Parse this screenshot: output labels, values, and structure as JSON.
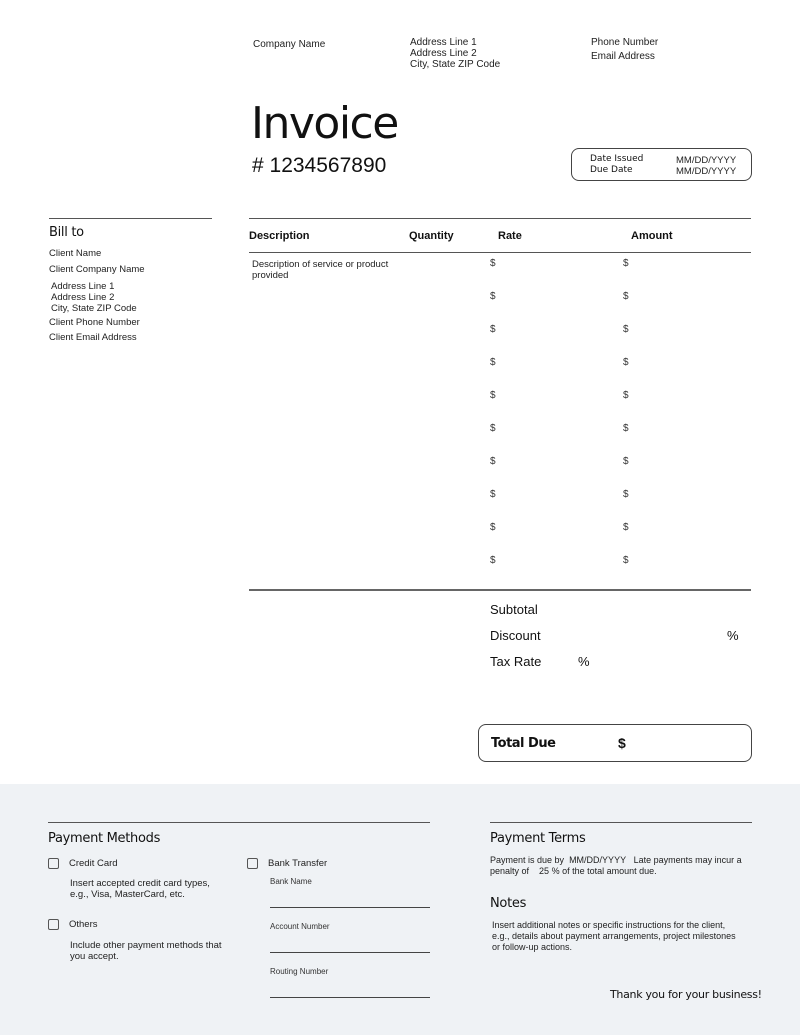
{
  "company": {
    "name": "Company Name",
    "address": [
      "Address Line 1",
      "Address Line 2",
      "City, State ZIP Code"
    ],
    "contact": [
      "Phone Number",
      "Email Address"
    ]
  },
  "invoice": {
    "title": "Invoice",
    "number": "# 1234567890"
  },
  "dates": {
    "issued_label": "Date Issued",
    "issued_value": "MM/DD/YYYY",
    "due_label": "Due Date",
    "due_value": "MM/DD/YYYY"
  },
  "bill_to": {
    "title": "Bill to",
    "client_name": "Client Name",
    "company_name": "Client Company Name",
    "address": [
      "Address Line 1",
      "Address Line 2",
      "City, State ZIP Code"
    ],
    "phone": "Client Phone Number",
    "email": "Client Email Address"
  },
  "table": {
    "headers": [
      "Description",
      "Quantity",
      "Rate",
      "Amount"
    ],
    "rows": [
      {
        "description": "Description of service or product provided",
        "quantity": "",
        "rate": "$",
        "amount": "$"
      },
      {
        "description": "",
        "quantity": "",
        "rate": "$",
        "amount": "$"
      },
      {
        "description": "",
        "quantity": "",
        "rate": "$",
        "amount": "$"
      },
      {
        "description": "",
        "quantity": "",
        "rate": "$",
        "amount": "$"
      },
      {
        "description": "",
        "quantity": "",
        "rate": "$",
        "amount": "$"
      },
      {
        "description": "",
        "quantity": "",
        "rate": "$",
        "amount": "$"
      },
      {
        "description": "",
        "quantity": "",
        "rate": "$",
        "amount": "$"
      },
      {
        "description": "",
        "quantity": "",
        "rate": "$",
        "amount": "$"
      },
      {
        "description": "",
        "quantity": "",
        "rate": "$",
        "amount": "$"
      },
      {
        "description": "",
        "quantity": "",
        "rate": "$",
        "amount": "$"
      }
    ]
  },
  "totals": {
    "subtotal_label": "Subtotal",
    "discount_label": "Discount",
    "discount_unit": "%",
    "tax_label": "Tax Rate",
    "tax_unit": "%",
    "total_label": "Total Due",
    "total_currency": "$"
  },
  "payment_methods": {
    "title": "Payment Methods",
    "credit_card": {
      "label": "Credit Card",
      "checked": false,
      "note": [
        "Insert accepted credit card types,",
        "e.g., Visa, MasterCard, etc."
      ]
    },
    "others": {
      "label": "Others",
      "checked": false,
      "note": [
        "Include other payment methods that",
        "you accept."
      ]
    },
    "bank_transfer": {
      "label": "Bank Transfer",
      "checked": false,
      "fields": [
        "Bank Name",
        "Account Number",
        "Routing Number"
      ]
    }
  },
  "payment_terms": {
    "title": "Payment Terms",
    "line1_a": "Payment is due by",
    "due_date": "MM/DD/YYYY",
    "line1_b": "Late payments may incur a",
    "line2_a": "penalty of",
    "penalty": "25",
    "line2_b": "% of the total amount due."
  },
  "notes": {
    "title": "Notes",
    "text": [
      "Insert additional notes or specific instructions for the client,",
      "e.g., details about payment arrangements, project milestones",
      "or follow-up actions."
    ]
  },
  "footer": {
    "thanks": "Thank you for your business!"
  }
}
